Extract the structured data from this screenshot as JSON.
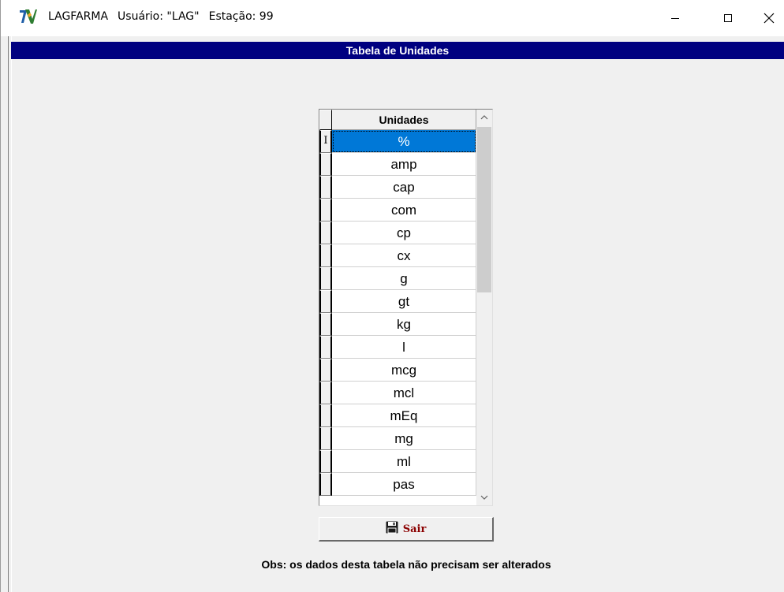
{
  "window": {
    "title_app": "LAGFARMA",
    "title_user": "Usuário: \"LAG\"",
    "title_station": "Estação: 99",
    "icon": "lagfarma-logo-icon",
    "controls": [
      "minimize-icon",
      "maximize-icon",
      "close-icon"
    ]
  },
  "header": {
    "title": "Tabela de Unidades",
    "background": "#000080"
  },
  "grid": {
    "column_header": "Unidades",
    "current_row_marker": "I",
    "selected_index": 0,
    "selection_color": "#0078d7",
    "rows": [
      "%",
      "amp",
      "cap",
      "com",
      "cp",
      "cx",
      "g",
      "gt",
      "kg",
      "l",
      "mcg",
      "mcl",
      "mEq",
      "mg",
      "ml",
      "pas"
    ]
  },
  "buttons": {
    "sair_label": "Sair",
    "sair_icon": "floppy-disk-icon"
  },
  "footer": {
    "note": "Obs: os dados desta tabela não precisam ser alterados"
  }
}
